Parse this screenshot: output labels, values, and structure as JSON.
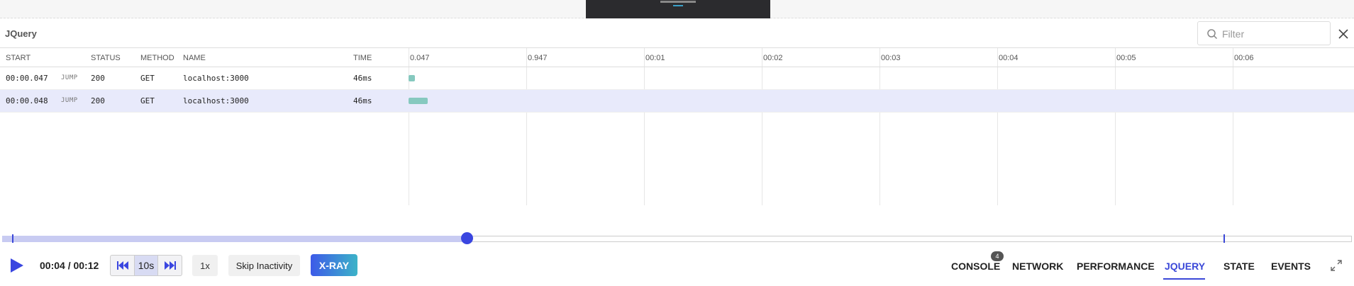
{
  "panel": {
    "title": "JQuery"
  },
  "filter": {
    "placeholder": "Filter"
  },
  "columns": {
    "start": "START",
    "status": "STATUS",
    "method": "METHOD",
    "name": "NAME",
    "time": "TIME"
  },
  "ticks": [
    "0.047",
    "0.947",
    "00:01",
    "00:02",
    "00:03",
    "00:04",
    "00:05",
    "00:06"
  ],
  "rows": [
    {
      "start": "00:00.047",
      "jump": "JUMP",
      "status": "200",
      "method": "GET",
      "name": "localhost:3000",
      "time": "46ms",
      "selected": false
    },
    {
      "start": "00:00.048",
      "jump": "JUMP",
      "status": "200",
      "method": "GET",
      "name": "localhost:3000",
      "time": "46ms",
      "selected": true
    }
  ],
  "player": {
    "time": "00:04 / 00:12",
    "skip_seconds": "10s",
    "speed": "1x",
    "skip_inactivity": "Skip Inactivity",
    "xray": "X-RAY",
    "progress_fraction": 0.344
  },
  "tabs": [
    {
      "label": "CONSOLE",
      "badge": "4"
    },
    {
      "label": "NETWORK"
    },
    {
      "label": "PERFORMANCE"
    },
    {
      "label": "JQUERY",
      "active": true
    },
    {
      "label": "STATE"
    },
    {
      "label": "EVENTS"
    }
  ],
  "colors": {
    "accent": "#3b48d8",
    "selected_row": "#e8eafb",
    "timing_bar": "#86c9bf",
    "track_fill": "#c8cbf2"
  }
}
